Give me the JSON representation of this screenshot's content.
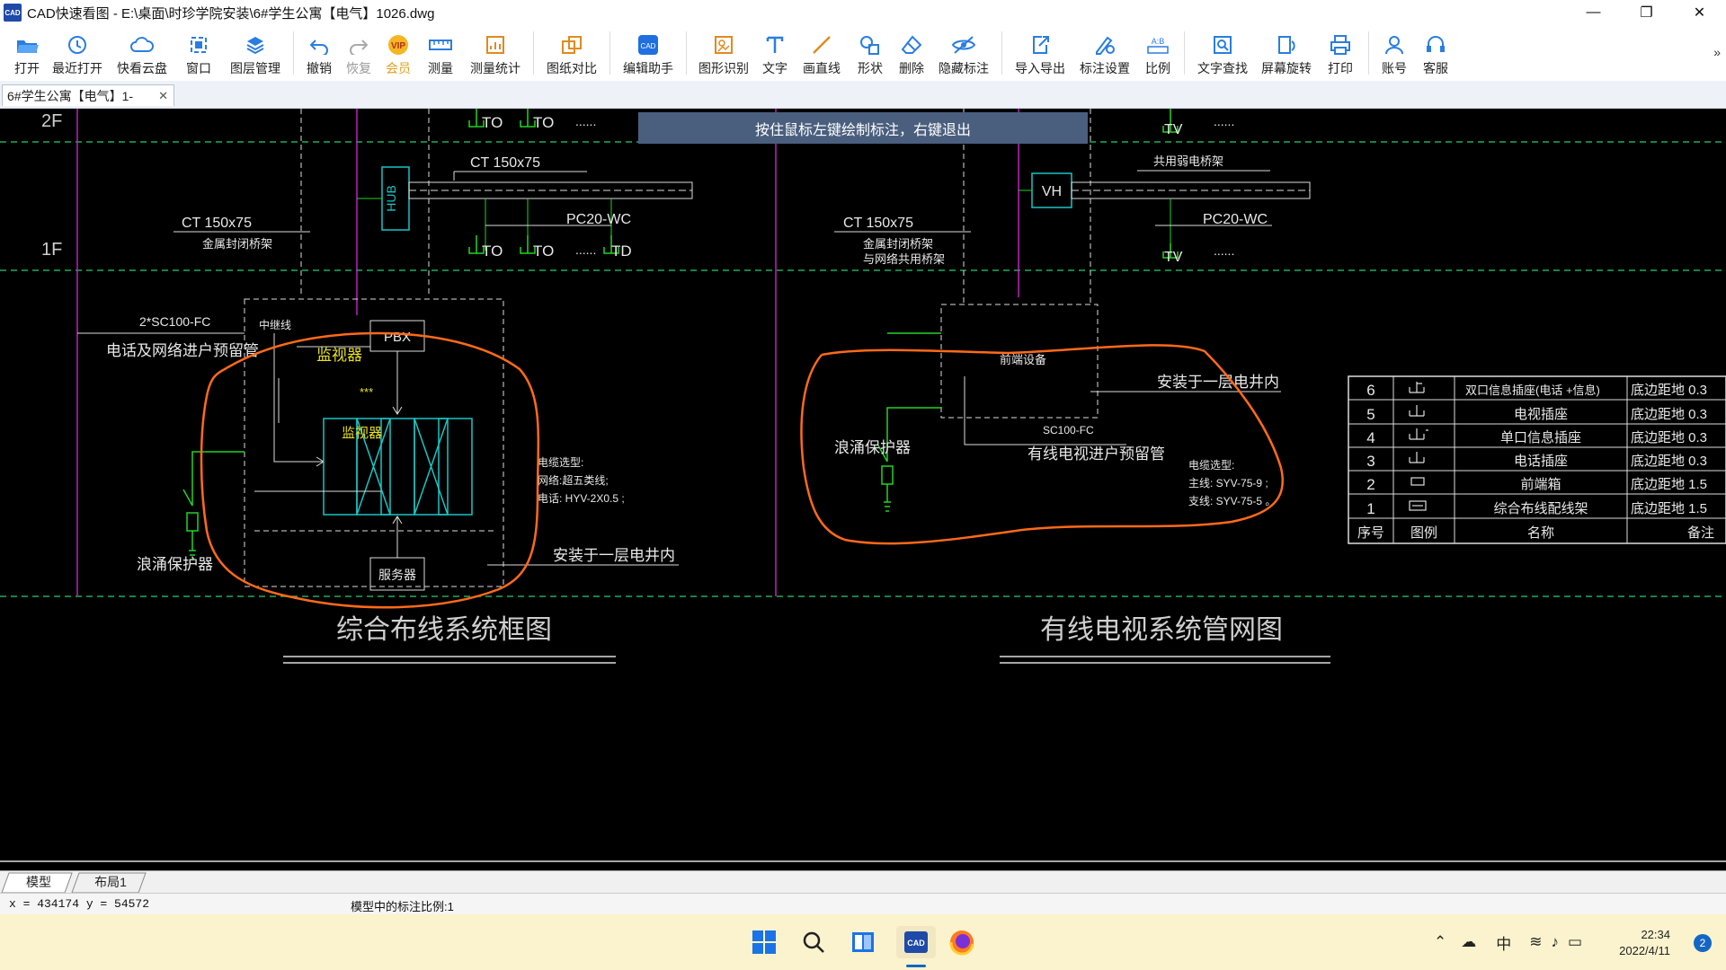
{
  "window": {
    "title": "CAD快速看图 - E:\\桌面\\时珍学院安装\\6#学生公寓【电气】1026.dwg",
    "app_icon_text": "CAD",
    "minimize": "—",
    "maximize": "❐",
    "close": "✕"
  },
  "toolbar": {
    "items": [
      {
        "label": "打开",
        "icon": "folder-open-icon"
      },
      {
        "label": "最近打开",
        "icon": "recent-clock-icon"
      },
      {
        "label": "快看云盘",
        "icon": "cloud-icon"
      },
      {
        "label": "窗口",
        "icon": "window-frame-icon"
      },
      {
        "label": "图层管理",
        "icon": "layers-icon"
      },
      {
        "label": "撤销",
        "icon": "undo-icon"
      },
      {
        "label": "恢复",
        "icon": "redo-icon"
      },
      {
        "label": "会员",
        "icon": "vip-icon"
      },
      {
        "label": "测量",
        "icon": "ruler-icon"
      },
      {
        "label": "测量统计",
        "icon": "measure-stats-icon"
      },
      {
        "label": "图纸对比",
        "icon": "compare-icon"
      },
      {
        "label": "编辑助手",
        "icon": "edit-cad-icon"
      },
      {
        "label": "图形识别",
        "icon": "shape-recognize-icon"
      },
      {
        "label": "文字",
        "icon": "text-t-icon"
      },
      {
        "label": "画直线",
        "icon": "line-icon"
      },
      {
        "label": "形状",
        "icon": "shape-icon"
      },
      {
        "label": "删除",
        "icon": "eraser-icon"
      },
      {
        "label": "隐藏标注",
        "icon": "hide-eye-icon"
      },
      {
        "label": "导入导出",
        "icon": "import-export-icon"
      },
      {
        "label": "标注设置",
        "icon": "annotation-settings-icon"
      },
      {
        "label": "比例",
        "icon": "scale-ab-icon"
      },
      {
        "label": "文字查找",
        "icon": "text-search-icon"
      },
      {
        "label": "屏幕旋转",
        "icon": "rotate-screen-icon"
      },
      {
        "label": "打印",
        "icon": "printer-icon"
      },
      {
        "label": "账号",
        "icon": "user-icon"
      },
      {
        "label": "客服",
        "icon": "headset-icon"
      }
    ],
    "more": "»"
  },
  "doc_tab": {
    "label": "6#学生公寓【电气】1-",
    "close": "✕"
  },
  "banner": "按住鼠标左键绘制标注，右键退出",
  "drawing": {
    "floor_2f": "2F",
    "floor_1f": "1F",
    "left": {
      "to_labels": [
        "TO",
        "TO",
        "TO",
        "TO",
        "TD"
      ],
      "dots": "......",
      "ct_top": "CT 150x75",
      "hub": "HUB",
      "pc20": "PC20-WC",
      "ct_left": "CT 150x75",
      "metal_tray": "金属封闭桥架",
      "sc100": "2*SC100-FC",
      "incoming": "电话及网络进户预留管",
      "trunk": "中继线",
      "pbx": "PBX",
      "monitor1": "监视器",
      "stars": "***",
      "monitor2": "监视器",
      "server": "服务器",
      "surge": "浪涌保护器",
      "cable_title": "电缆选型:",
      "cable_net": "网络:超五类线;",
      "cable_phone": "电话:  HYV-2X0.5        ;",
      "install": "安装于一层电井内",
      "caption": "综合布线系统框图"
    },
    "right": {
      "tv": "TV",
      "dots": "......",
      "shared_tray": "共用弱电桥架",
      "vh": "VH",
      "pc20": "PC20-WC",
      "ct": "CT 150x75",
      "metal_tray_1": "金属封闭桥架",
      "metal_tray_2": "与网络共用桥架",
      "frontend": "前端设备",
      "install": "安装于一层电井内",
      "sc100": "SC100-FC",
      "incoming": "有线电视进户预留管",
      "surge": "浪涌保护器",
      "cable_title": "电缆选型:",
      "cable_main": "主线:  SYV-75-9      ;",
      "cable_branch": "支线:  SYV-75-5      。",
      "caption": "有线电视系统管网图"
    },
    "legend": {
      "rows": [
        {
          "no": "6",
          "name": "双口信息插座(电话  +信息)",
          "note": "底边距地 0.3"
        },
        {
          "no": "5",
          "name": "电视插座",
          "note": "底边距地 0.3"
        },
        {
          "no": "4",
          "name": "单口信息插座",
          "note": "底边距地 0.3"
        },
        {
          "no": "3",
          "name": "电话插座",
          "note": "底边距地 0.3"
        },
        {
          "no": "2",
          "name": "前端箱",
          "note": "底边距地 1.5"
        },
        {
          "no": "1",
          "name": "综合布线配线架",
          "note": "底边距地 1.5"
        }
      ],
      "header": {
        "no": "序号",
        "symbol": "图例",
        "name": "名称",
        "note": "备注"
      }
    }
  },
  "sheet_tabs": {
    "model": "模型",
    "layout": "布局1"
  },
  "status": {
    "coords": "x = 434174  y = 54572",
    "scale": "模型中的标注比例:1"
  },
  "taskbar": {
    "icons": [
      "windows-start-icon",
      "search-icon",
      "file-explorer-icon",
      "cad-app-icon",
      "firefox-icon"
    ],
    "tray_ime": "中",
    "time": "22:34",
    "date": "2022/4/11",
    "notifications": "2"
  },
  "colors": {
    "annotation": "#ff6a1a",
    "cyan": "#19c6c6",
    "green": "#22d422",
    "magenta": "#c020c0",
    "yellow": "#e8e020",
    "banner": "#4a5f7e"
  }
}
